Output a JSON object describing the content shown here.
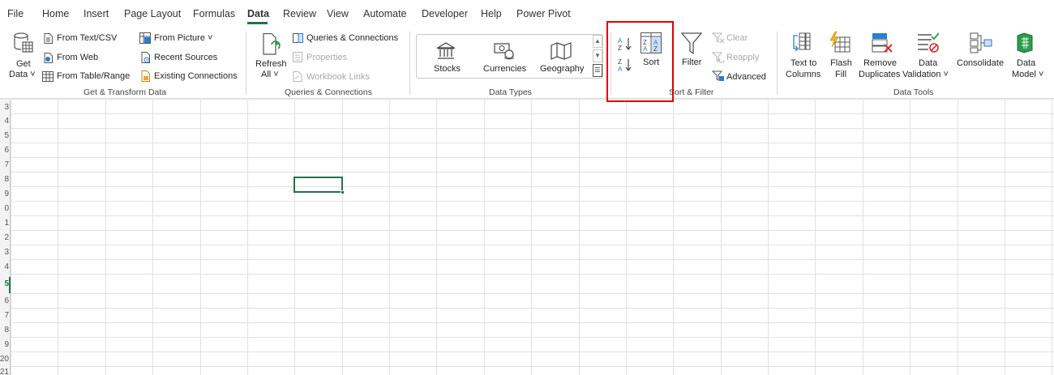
{
  "tabs": [
    "File",
    "Home",
    "Insert",
    "Page Layout",
    "Formulas",
    "Data",
    "Review",
    "View",
    "Automate",
    "Developer",
    "Help",
    "Power Pivot"
  ],
  "active_tab": "Data",
  "ribbon": {
    "get_data": {
      "line1": "Get",
      "line2": "Data ˅"
    },
    "from_text_csv": "From Text/CSV",
    "from_web": "From Web",
    "from_table_range": "From Table/Range",
    "from_picture": "From Picture ˅",
    "recent_sources": "Recent Sources",
    "existing_connections": "Existing Connections",
    "group_get_transform": "Get & Transform Data",
    "refresh_all": {
      "line1": "Refresh",
      "line2": "All ˅"
    },
    "queries_connections": "Queries & Connections",
    "properties": "Properties",
    "workbook_links": "Workbook Links",
    "group_queries": "Queries & Connections",
    "stocks": "Stocks",
    "currencies": "Currencies",
    "geography": "Geography",
    "group_data_types": "Data Types",
    "sort": "Sort",
    "filter": "Filter",
    "clear": "Clear",
    "reapply": "Reapply",
    "advanced": "Advanced",
    "group_sort_filter": "Sort & Filter",
    "text_to_columns": {
      "line1": "Text to",
      "line2": "Columns"
    },
    "flash_fill": {
      "line1": "Flash",
      "line2": "Fill"
    },
    "remove_duplicates": {
      "line1": "Remove",
      "line2": "Duplicates"
    },
    "data_validation": {
      "line1": "Data",
      "line2": "Validation ˅"
    },
    "consolidate": "Consolidate",
    "data_model": {
      "line1": "Data",
      "line2": "Model ˅"
    },
    "group_data_tools": "Data Tools"
  },
  "rows": [
    "3",
    "4",
    "5",
    "6",
    "7",
    "8",
    "9",
    "0",
    "1",
    "2",
    "3",
    "4",
    "5",
    "6",
    "7",
    "8",
    "9",
    "20",
    "21"
  ],
  "selected_row": "5",
  "colors": {
    "accent": "#217346",
    "highlight_box": "#e00000"
  }
}
